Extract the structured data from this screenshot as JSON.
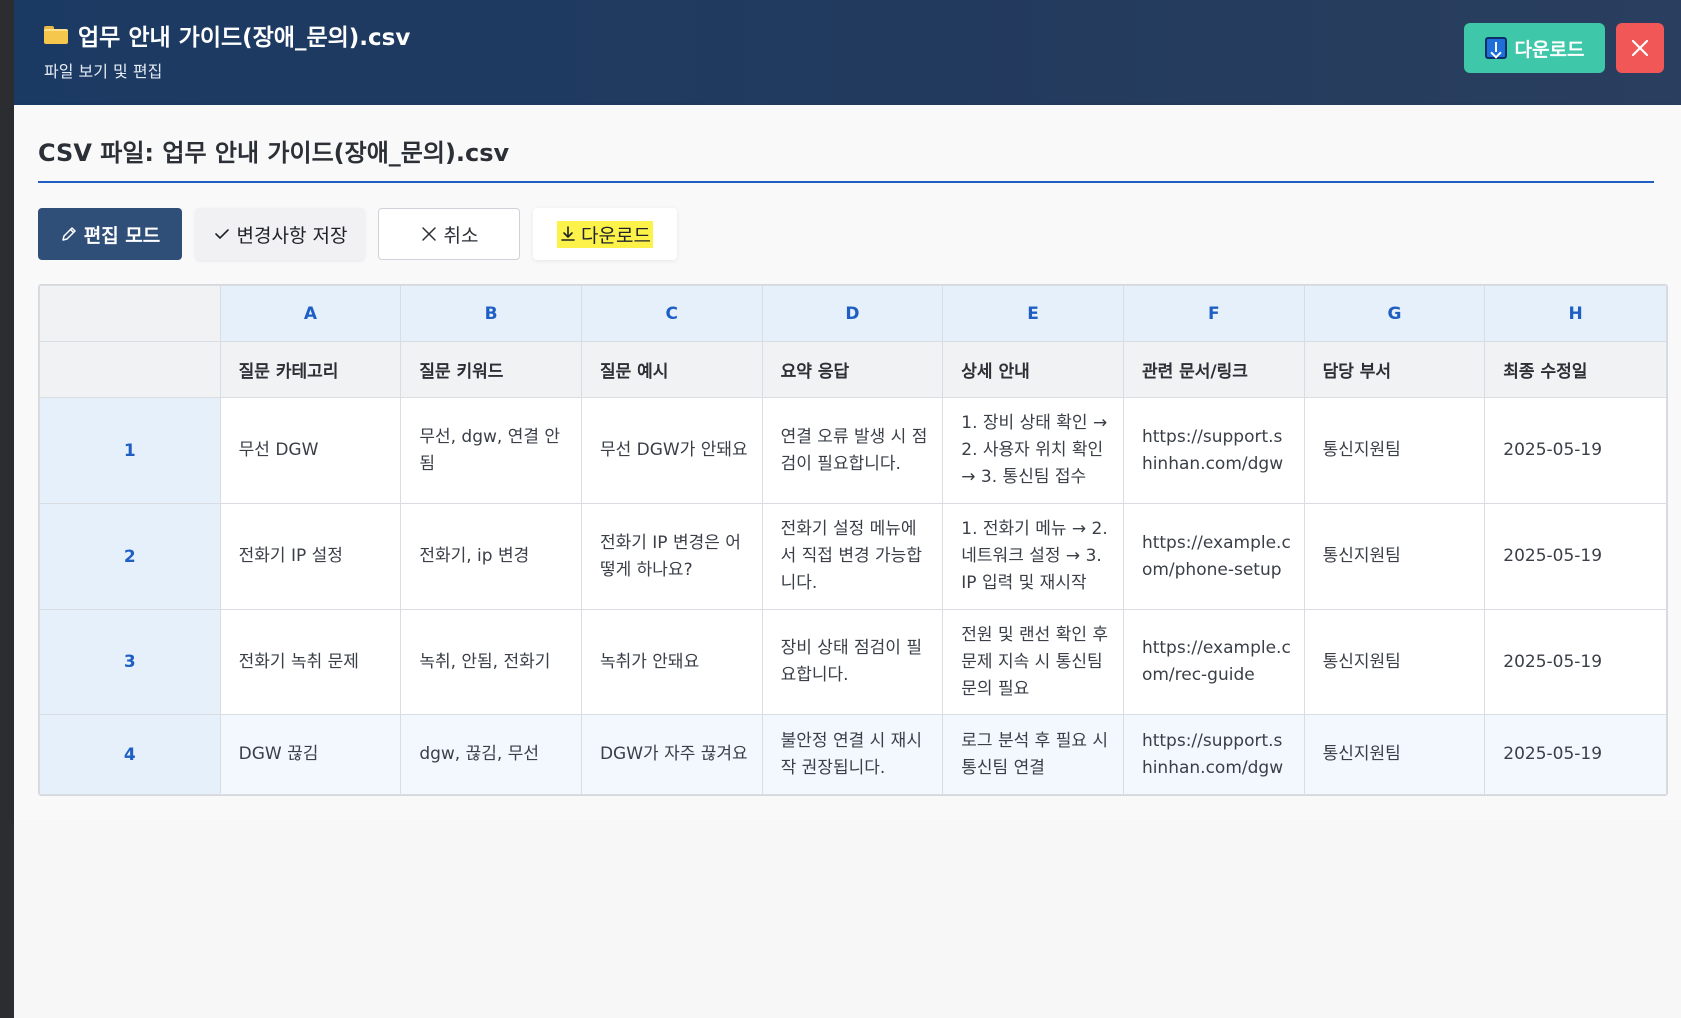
{
  "header": {
    "title": "업무 안내 가이드(장애_문의).csv",
    "subtitle": "파일 보기 및 편집",
    "download_label": "다운로드",
    "folder_icon": "folder-icon",
    "close_icon": "close-icon"
  },
  "content": {
    "csv_title": "CSV 파일: 업무 안내 가이드(장애_문의).csv"
  },
  "toolbar": {
    "edit_label": "편집 모드",
    "save_label": "변경사항 저장",
    "cancel_label": "취소",
    "download_label": "다운로드"
  },
  "table": {
    "column_letters": [
      "A",
      "B",
      "C",
      "D",
      "E",
      "F",
      "G",
      "H"
    ],
    "headers": [
      "질문 카테고리",
      "질문 키워드",
      "질문 예시",
      "요약 응답",
      "상세 안내",
      "관련 문서/링크",
      "담당 부서",
      "최종 수정일"
    ],
    "rows": [
      {
        "num": "1",
        "cells": [
          "무선 DGW",
          "무선, dgw, 연결 안됨",
          "무선 DGW가 안돼요",
          "연결 오류 발생 시 점검이 필요합니다.",
          "1. 장비 상태 확인 → 2. 사용자 위치 확인 → 3. 통신팀 접수",
          "https://support.shinhan.com/dgw",
          "통신지원팀",
          "2025-05-19"
        ]
      },
      {
        "num": "2",
        "cells": [
          "전화기 IP 설정",
          "전화기, ip 변경",
          "전화기 IP 변경은 어떻게 하나요?",
          "전화기 설정 메뉴에서 직접 변경 가능합니다.",
          "1. 전화기 메뉴 → 2. 네트워크 설정 → 3. IP 입력 및 재시작",
          "https://example.com/phone-setup",
          "통신지원팀",
          "2025-05-19"
        ]
      },
      {
        "num": "3",
        "cells": [
          "전화기 녹취 문제",
          "녹취, 안됨, 전화기",
          "녹취가 안돼요",
          "장비 상태 점검이 필요합니다.",
          "전원 및 랜선 확인 후 문제 지속 시 통신팀 문의 필요",
          "https://example.com/rec-guide",
          "통신지원팀",
          "2025-05-19"
        ]
      },
      {
        "num": "4",
        "cells": [
          "DGW 끊김",
          "dgw, 끊김, 무선",
          "DGW가 자주 끊겨요",
          "불안정 연결 시 재시작 권장됩니다.",
          "로그 분석 후 필요 시 통신팀 연결",
          "https://support.shinhan.com/dgw",
          "통신지원팀",
          "2025-05-19"
        ]
      }
    ]
  },
  "colors": {
    "header_bg": "#1b3a63",
    "download_btn": "#3ec7a8",
    "close_btn": "#f25757",
    "accent": "#1f5fc4",
    "edit_btn": "#2f4f78",
    "highlight": "#fdf24a"
  }
}
